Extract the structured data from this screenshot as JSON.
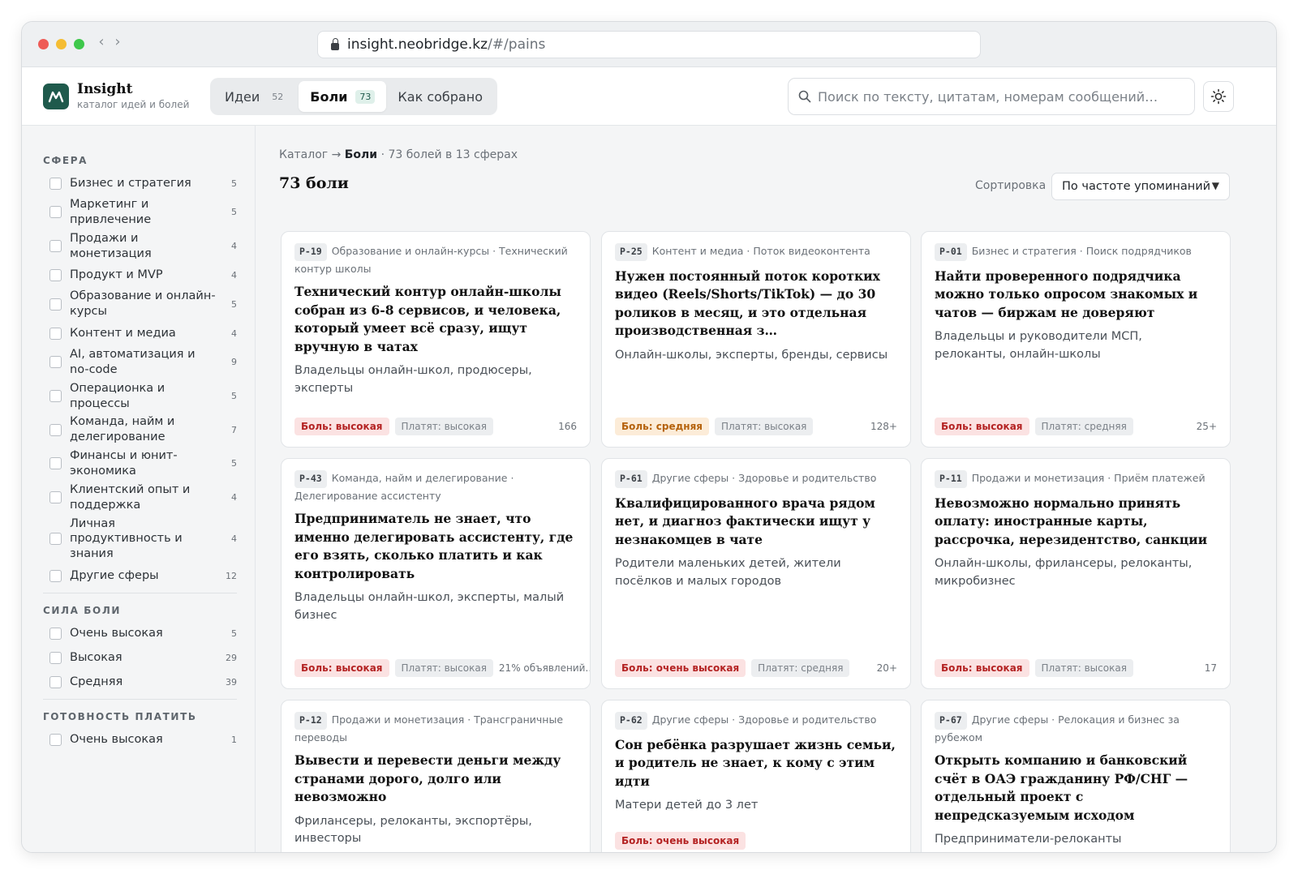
{
  "browser": {
    "url_host": "insight.neobridge.kz",
    "url_path": "/#/pains"
  },
  "header": {
    "brand_title": "Insight",
    "brand_subtitle": "каталог идей и болей",
    "tabs": [
      {
        "label": "Идеи",
        "count": "52"
      },
      {
        "label": "Боли",
        "count": "73"
      },
      {
        "label": "Как собрано"
      }
    ],
    "search_placeholder": "Поиск по тексту, цитатам, номерам сообщений…"
  },
  "sidebar": {
    "sphere_title": "СФЕРА",
    "spheres": [
      {
        "label": "Бизнес и стратегия",
        "count": "5"
      },
      {
        "label": "Маркетинг и привлечение",
        "count": "5"
      },
      {
        "label": "Продажи и монетизация",
        "count": "4"
      },
      {
        "label": "Продукт и MVP",
        "count": "4"
      },
      {
        "label": "Образование и онлайн-курсы",
        "count": "5"
      },
      {
        "label": "Контент и медиа",
        "count": "4"
      },
      {
        "label": "AI, автоматизация и no-code",
        "count": "9"
      },
      {
        "label": "Операционка и процессы",
        "count": "5"
      },
      {
        "label": "Команда, найм и делегирование",
        "count": "7"
      },
      {
        "label": "Финансы и юнит-экономика",
        "count": "5"
      },
      {
        "label": "Клиентский опыт и поддержка",
        "count": "4"
      },
      {
        "label": "Личная продуктивность и знания",
        "count": "4"
      },
      {
        "label": "Другие сферы",
        "count": "12"
      }
    ],
    "pain_title": "СИЛА БОЛИ",
    "pain_levels": [
      {
        "label": "Очень высокая",
        "count": "5"
      },
      {
        "label": "Высокая",
        "count": "29"
      },
      {
        "label": "Средняя",
        "count": "39"
      }
    ],
    "pay_title": "ГОТОВНОСТЬ ПЛАТИТЬ",
    "pay_levels": [
      {
        "label": "Очень высокая",
        "count": "1"
      }
    ]
  },
  "main": {
    "breadcrumb_root": "Каталог",
    "breadcrumb_arrow": "→",
    "breadcrumb_current": "Боли",
    "breadcrumb_info": "· 73 болей в 13 сферах",
    "title": "73 боли",
    "sort_label": "Сортировка",
    "sort_value": "По частоте упоминаний",
    "cards": [
      {
        "id": "P-19",
        "meta": "Образование и онлайн-курсы · Технический контур школы",
        "title": "Технический контур онлайн-школы собран из 6-8 сервисов, и человека, который умеет всё сразу, ищут вручную в чатах",
        "audience": "Владельцы онлайн-школ, продюсеры, эксперты",
        "pain": "Боль: высокая",
        "pay": "Платят: высокая",
        "mentions": "166"
      },
      {
        "id": "P-25",
        "meta": "Контент и медиа · Поток видеоконтента",
        "title": "Нужен постоянный поток коротких видео (Reels/Shorts/TikTok) — до 30 роликов в месяц, и это отдельная производственная з…",
        "audience": "Онлайн-школы, эксперты, бренды, сервисы",
        "pain": "Боль: средняя",
        "pay": "Платят: высокая",
        "mentions": "128+"
      },
      {
        "id": "P-01",
        "meta": "Бизнес и стратегия · Поиск подрядчиков",
        "title": "Найти проверенного подрядчика можно только опросом знакомых и чатов — биржам не доверяют",
        "audience": "Владельцы и руководители МСП, релоканты, онлайн-школы",
        "pain": "Боль: высокая",
        "pay": "Платят: средняя",
        "mentions": "25+"
      },
      {
        "id": "P-43",
        "meta": "Команда, найм и делегирование · Делегирование ассистенту",
        "title": "Предприниматель не знает, что именно делегировать ассистенту, где его взять, сколько платить и как контролировать",
        "audience": "Владельцы онлайн-школ, эксперты, малый бизнес",
        "pain": "Боль: высокая",
        "pay": "Платят: высокая",
        "mentions": "21% объявлений…"
      },
      {
        "id": "P-61",
        "meta": "Другие сферы · Здоровье и родительство",
        "title": "Квалифицированного врача рядом нет, и диагноз фактически ищут у незнакомцев в чате",
        "audience": "Родители маленьких детей, жители посёлков и малых городов",
        "pain": "Боль: очень высокая",
        "pay": "Платят: средняя",
        "mentions": "20+"
      },
      {
        "id": "P-11",
        "meta": "Продажи и монетизация · Приём платежей",
        "title": "Невозможно нормально принять оплату: иностранные карты, рассрочка, нерезидентство, санкции",
        "audience": "Онлайн-школы, фрилансеры, релоканты, микробизнес",
        "pain": "Боль: высокая",
        "pay": "Платят: высокая",
        "mentions": "17"
      },
      {
        "id": "P-12",
        "meta": "Продажи и монетизация · Трансграничные переводы",
        "title": "Вывести и перевести деньги между странами дорого, долго или невозможно",
        "audience": "Фрилансеры, релоканты, экспортёры, инвесторы",
        "pain": "",
        "pay": "",
        "mentions": ""
      },
      {
        "id": "P-62",
        "meta": "Другие сферы · Здоровье и родительство",
        "title": "Сон ребёнка разрушает жизнь семьи, и родитель не знает, к кому с этим идти",
        "audience": "Матери детей до 3 лет",
        "pain": "Боль: очень высокая",
        "pay": "",
        "mentions": ""
      },
      {
        "id": "P-67",
        "meta": "Другие сферы · Релокация и бизнес за рубежом",
        "title": "Открыть компанию и банковский счёт в ОАЭ гражданину РФ/СНГ — отдельный проект с непредсказуемым исходом",
        "audience": "Предприниматели-релоканты",
        "pain": "",
        "pay": "",
        "mentions": ""
      }
    ]
  },
  "colors": {
    "brand": "#1f5a4c",
    "pain_high_bg": "#fbe2e2",
    "pain_high_text": "#b42323",
    "pain_mid_bg": "#fcecd8",
    "pain_mid_text": "#b5620c"
  },
  "icons": {
    "logo": "brand-logo-icon",
    "lock": "lock-icon",
    "search": "search-icon",
    "theme": "sun-icon"
  }
}
